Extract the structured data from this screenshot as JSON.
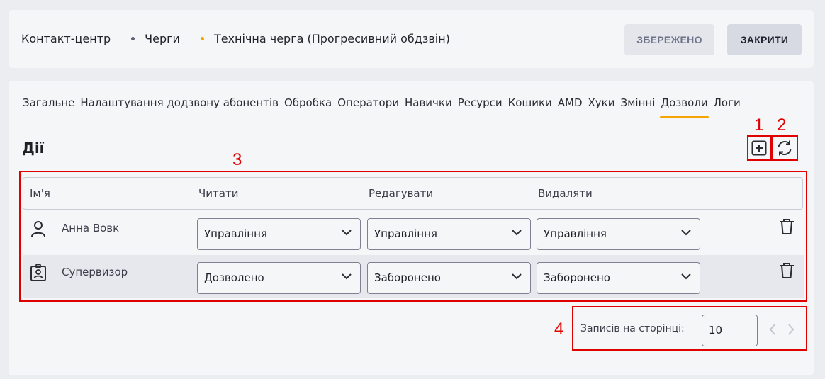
{
  "header": {
    "breadcrumbs": [
      "Контакт-центр",
      "Черги",
      "Технічна черга (Прогресивний обдзвін)"
    ],
    "saved_label": "ЗБЕРЕЖЕНО",
    "close_label": "ЗАКРИТИ"
  },
  "tabs": [
    "Загальне",
    "Налаштування додзвону абонентів",
    "Обробка",
    "Оператори",
    "Навички",
    "Ресурси",
    "Кошики",
    "AMD",
    "Хуки",
    "Змінні",
    "Дозволи",
    "Логи"
  ],
  "active_tab": "Дозволи",
  "section": {
    "title": "Дії"
  },
  "annotations": [
    "1",
    "2",
    "3",
    "4"
  ],
  "table": {
    "columns": [
      "Ім'я",
      "Читати",
      "Редагувати",
      "Видаляти"
    ],
    "rows": [
      {
        "icon": "user-icon",
        "name": "Анна Вовк",
        "read": "Управління",
        "edit": "Управління",
        "delete": "Управління"
      },
      {
        "icon": "badge-icon",
        "name": "Супервизор",
        "read": "Дозволено",
        "edit": "Заборонено",
        "delete": "Заборонено"
      }
    ]
  },
  "pagination": {
    "label": "Записів на сторінці:",
    "per_page": "10"
  },
  "colors": {
    "accent": "#f5a400",
    "annotation": "#e00000",
    "crumb_dot_1": "#5a5f73",
    "crumb_dot_2": "#f5a400"
  }
}
